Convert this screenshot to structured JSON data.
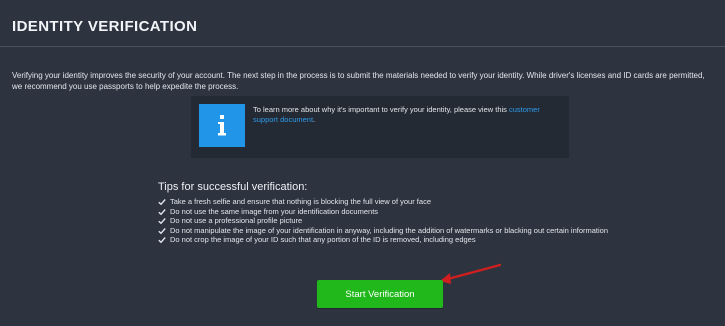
{
  "header": {
    "title": "IDENTITY VERIFICATION"
  },
  "intro": {
    "text": "Verifying your identity improves the security of your account. The next step in the process is to submit the materials needed to verify your identity. While driver's licenses and ID cards are permitted, we recommend you use passports to help expedite the process."
  },
  "info": {
    "icon": "info-icon",
    "text_before": "To learn more about why it's important to verify your identity, please view this ",
    "link_text": "customer support document",
    "text_after": "."
  },
  "tips": {
    "heading": "Tips for successful verification:",
    "items": [
      "Take a fresh selfie and ensure that nothing is blocking the full view of your face",
      "Do not use the same image from your identification documents",
      "Do not use a professional profile picture",
      "Do not manipulate the image of your identification in anyway, including the addition of watermarks or blacking out certain information",
      "Do not crop the image of your ID such that any portion of the ID is removed, including edges"
    ]
  },
  "actions": {
    "start_label": "Start Verification"
  },
  "colors": {
    "background": "#2d3440",
    "info_box": "#232a34",
    "info_tile": "#2196e8",
    "link": "#2f9bea",
    "button": "#20b81b",
    "annotation_arrow": "#d11f1f"
  }
}
